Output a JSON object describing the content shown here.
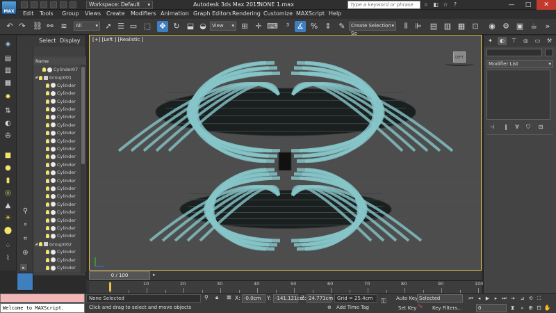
{
  "window": {
    "app_title": "Autodesk 3ds Max  2015",
    "file_name": "NONE 1.max",
    "workspace": "Workspace: Default",
    "search_placeholder": "Type a keyword or phrase",
    "logo_text": "MAX",
    "minimize": "—",
    "maximize": "□",
    "close": "✕"
  },
  "menu": [
    "Edit",
    "Tools",
    "Group",
    "Views",
    "Create",
    "Modifiers",
    "Animation",
    "Graph Editors",
    "Rendering",
    "Customize",
    "MAXScript",
    "Help"
  ],
  "toolbar": {
    "filter_select": "All",
    "ref_coord_select": "View",
    "named_selection": "Create Selection Se"
  },
  "scene_explorer": {
    "tabs": [
      "Select",
      "Display"
    ],
    "column_header": "Name",
    "rows": [
      {
        "label": "Cylinder07",
        "indent": 1,
        "kind": "obj",
        "expand": ""
      },
      {
        "label": "Group001",
        "indent": 0,
        "kind": "grp",
        "expand": "◢"
      },
      {
        "label": "Cylinder",
        "indent": 2,
        "kind": "obj",
        "expand": ""
      },
      {
        "label": "Cylinder",
        "indent": 2,
        "kind": "obj",
        "expand": ""
      },
      {
        "label": "Cylinder",
        "indent": 2,
        "kind": "obj",
        "expand": ""
      },
      {
        "label": "Cylinder",
        "indent": 2,
        "kind": "obj",
        "expand": ""
      },
      {
        "label": "Cylinder",
        "indent": 2,
        "kind": "obj",
        "expand": ""
      },
      {
        "label": "Cylinder",
        "indent": 2,
        "kind": "obj",
        "expand": ""
      },
      {
        "label": "Cylinder",
        "indent": 2,
        "kind": "obj",
        "expand": ""
      },
      {
        "label": "Cylinder",
        "indent": 2,
        "kind": "obj",
        "expand": ""
      },
      {
        "label": "Cylinder",
        "indent": 2,
        "kind": "obj",
        "expand": ""
      },
      {
        "label": "Cylinder",
        "indent": 2,
        "kind": "obj",
        "expand": ""
      },
      {
        "label": "Cylinder",
        "indent": 2,
        "kind": "obj",
        "expand": ""
      },
      {
        "label": "Cylinder",
        "indent": 2,
        "kind": "obj",
        "expand": ""
      },
      {
        "label": "Cylinder",
        "indent": 2,
        "kind": "obj",
        "expand": ""
      },
      {
        "label": "Cylinder",
        "indent": 2,
        "kind": "obj",
        "expand": ""
      },
      {
        "label": "Cylinder",
        "indent": 2,
        "kind": "obj",
        "expand": ""
      },
      {
        "label": "Cylinder",
        "indent": 2,
        "kind": "obj",
        "expand": ""
      },
      {
        "label": "Cylinder",
        "indent": 2,
        "kind": "obj",
        "expand": ""
      },
      {
        "label": "Cylinder",
        "indent": 2,
        "kind": "obj",
        "expand": ""
      },
      {
        "label": "Cylinder",
        "indent": 2,
        "kind": "obj",
        "expand": ""
      },
      {
        "label": "Cylinder",
        "indent": 2,
        "kind": "obj",
        "expand": ""
      },
      {
        "label": "Group002",
        "indent": 0,
        "kind": "grp",
        "expand": "◢"
      },
      {
        "label": "Cylinder",
        "indent": 2,
        "kind": "obj",
        "expand": ""
      },
      {
        "label": "Cylinder",
        "indent": 2,
        "kind": "obj",
        "expand": ""
      },
      {
        "label": "Cylinder",
        "indent": 2,
        "kind": "obj",
        "expand": ""
      },
      {
        "label": "Cylinder",
        "indent": 2,
        "kind": "obj",
        "expand": ""
      },
      {
        "label": "Cylinder",
        "indent": 2,
        "kind": "obj",
        "expand": ""
      }
    ]
  },
  "viewport": {
    "label": "[+] [Left ] [Realistic ]",
    "viewcube_face": "LEFT",
    "axis_y": "y",
    "axis_z": "z",
    "ring_color": "#86c6c9",
    "core_color": "#1a1f1f"
  },
  "timeline": {
    "slider": "0 / 100",
    "ticks": [
      0,
      5,
      10,
      15,
      20,
      25,
      30,
      35,
      40,
      45,
      50,
      55,
      60,
      65,
      70,
      75,
      80,
      85,
      90,
      95,
      100
    ],
    "labels": [
      "10",
      "20",
      "30",
      "40",
      "50",
      "60",
      "70",
      "80",
      "90",
      "100"
    ]
  },
  "status": {
    "maxscript_listener": "Welcome to MAXScript.",
    "selection": "None Selected",
    "prompt": "Click and drag to select and move objects",
    "x_label": "X:",
    "x_value": "-0.0cm",
    "y_label": "Y:",
    "y_value": "-141.121cm",
    "z_label": "Z:",
    "z_value": "24.771cm",
    "grid": "Grid = 25.4cm",
    "add_time_tag": "Add Time Tag",
    "auto_key": "Auto Key",
    "auto_key_select": "Selected",
    "set_key": "Set Key",
    "key_filters": "Key Filters...",
    "frame": "0"
  },
  "command_panel": {
    "modifier_list": "Modifier List"
  }
}
